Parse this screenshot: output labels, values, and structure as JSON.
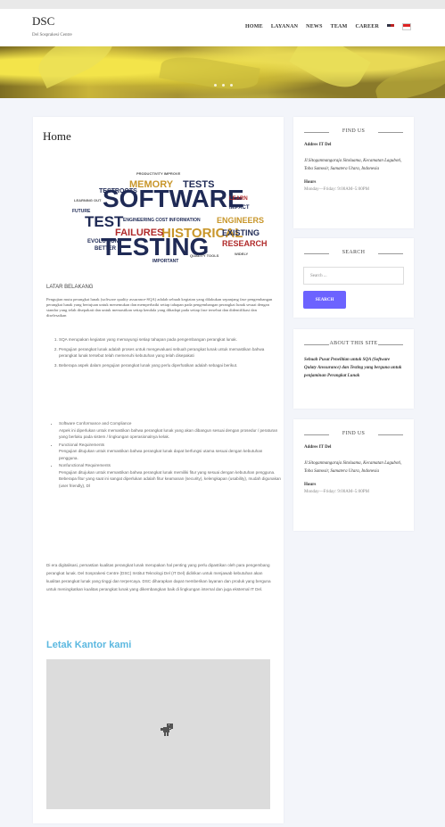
{
  "site": {
    "brand": "DSC",
    "tagline": "Del Sosprakesi Centre"
  },
  "nav": {
    "items": [
      "HOME",
      "LAYANAN",
      "NEWS",
      "TEAM",
      "CAREER"
    ],
    "flags": [
      "us-flag-icon",
      "id-flag-icon"
    ]
  },
  "hero": {
    "slides": 3
  },
  "main": {
    "title": "Home",
    "section_title": "LATAR BELAKANG",
    "intro": "Pengujian mutu perangkat lunak (software quality assurance-SQA) adalah sebuah kegiatan yang dilakukan sepanjang fase pengembangan perangkat lunak yang bertujuan untuk menemukan dan memperbaiki setiap tahapan pada pengembangan perangkat lunak sesuai dengan standar yang telah disepakati dan untuk memastikan setiap kendala yang dihadapi pada setiap fase tersebut dan didentifikasi dan diselesaikan",
    "steps": [
      "SQA merupakan kegiatan yang memayungi setiap tahapan pada pengembangan perangkat lunak.",
      "Pengujian perangkat lunak adalah proses untuk mengevaluasi sebuah perangkat lunak untuk memastikan bahwa perangkat lunak tersebut telah memenuhi kebutuhan yang telah disepakati",
      "Beberapa aspek dalam pengujian perangkat lunak yang perlu diperhatikan adalah sebagai berikut."
    ],
    "requirements": [
      {
        "title": "Software Conformance and Compliance",
        "text": "Aspek ini diperlukan untuk memastikan bahwa perangkat lunak yang akan dibangun sesuai dengan prosedur / peraturan yang berlaku pada sistem / lingkungan operasionalnya kelak."
      },
      {
        "title": "Functional Requirements",
        "text": "Pengujian ditujukan untuk memastikan bahwa perangkat lunak dapat berfungsi utama sesuai dengan kebutuhan pengguna."
      },
      {
        "title": "Nonfunctional Requirements",
        "text": "Pengujian ditujukan untuk memastikan bahwa perangkat lunak memiliki fitur yang sesuai dengan kebutuhan pengguna. Beberapa fitur yang saat ini sangat diperlukan adalah fitur keamanan (security), kelengkapan (usability), mudah digunakan (user friendly), Dl"
      }
    ],
    "closing": "Di era digitalisasi, pemastian kualitas perangkat lunak merupakan hal penting yang perlu dipastikan oleh para pengembang perangkat lunak. Del Sosprakesi Centre (DSC) Institut Teknologi Del (IT Del) didirikan untuk menjawab kebutuhan akan kualitas perangkat lunak yang tinggi dan terpercaya. DSC diharapkan dapat memberikan layanan dan produk yang berguna untuk meningkatkan kualitas perangkat lunak yang dikembangkan baik di lingkungan internal dan juga eksternal IT Del.",
    "location_title": "Letak Kantor kami"
  },
  "sidebar": {
    "find_us_title": "FIND US",
    "address_label": "Addres IT Del",
    "address": "Jl.Sitoganmangaraja Sitoluama, Kecamatan Laguboti, Toba Samosir, Sumatera Utara, Indonesia",
    "hours_label": "Hours",
    "hours": "Monday—Friday: 9:00AM–5:00PM",
    "search_title": "SEARCH",
    "search_placeholder": "Search ...",
    "search_button": "SEARCH",
    "about_title": "ABOUT THIS SITE",
    "about_text": "Sebuah Pusat Penelitian untuk SQA (Software Qulaty Anssurance) dan Testing yang berguna untuk penjaminan Perangkat Lunak"
  },
  "colors": {
    "accent": "#6c63ff",
    "heading_blue": "#5bb8e0",
    "cloud_navy": "#1f2a55",
    "cloud_red": "#b02a2a",
    "cloud_gold": "#c8962a"
  }
}
